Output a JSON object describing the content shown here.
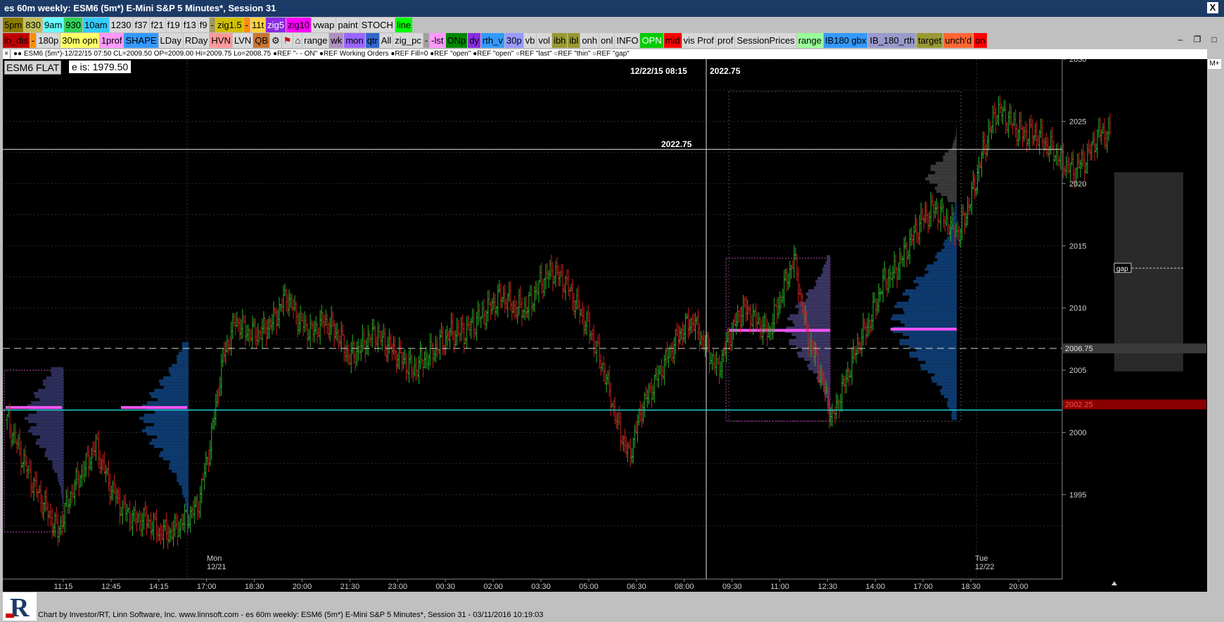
{
  "window": {
    "title": "es 60m weekly: ESM6 (5m*) E-Mini S&P 5 Minutes*, Session 31",
    "close_label": "X"
  },
  "toolbar1": [
    {
      "label": "5pm",
      "bg": "#8b7d00",
      "fg": "#000"
    },
    {
      "label": "830",
      "bg": "#c0c060",
      "fg": "#000"
    },
    {
      "label": "9am",
      "bg": "#66ffff",
      "fg": "#000"
    },
    {
      "label": "930",
      "bg": "#2fd35a",
      "fg": "#000"
    },
    {
      "label": "10am",
      "bg": "#33ccff",
      "fg": "#000"
    },
    {
      "label": "1230",
      "bg": "#d8d8d8",
      "fg": "#000"
    },
    {
      "label": "f37",
      "bg": "#d8d8d8",
      "fg": "#000"
    },
    {
      "label": "f21",
      "bg": "#d8d8d8",
      "fg": "#000"
    },
    {
      "label": "f19",
      "bg": "#d8d8d8",
      "fg": "#000"
    },
    {
      "label": "f13",
      "bg": "#d8d8d8",
      "fg": "#000"
    },
    {
      "label": "f9",
      "bg": "#d8d8d8",
      "fg": "#000"
    },
    {
      "label": "-",
      "bg": "#a09a60",
      "fg": "#000"
    },
    {
      "label": "zig1.5",
      "bg": "#d0c000",
      "fg": "#000"
    },
    {
      "label": "-",
      "bg": "#ff8c00",
      "fg": "#000"
    },
    {
      "label": "11t",
      "bg": "#ffd040",
      "fg": "#000"
    },
    {
      "label": "zig5",
      "bg": "#8a2be2",
      "fg": "#fff"
    },
    {
      "label": "zig10",
      "bg": "#ff00ff",
      "fg": "#000"
    },
    {
      "label": "vwap",
      "bg": "#d8d8d8",
      "fg": "#000"
    },
    {
      "label": "paint",
      "bg": "#d8d8d8",
      "fg": "#000"
    },
    {
      "label": "STOCH",
      "bg": "#d8d8d8",
      "fg": "#000"
    },
    {
      "label": "line",
      "bg": "#00ff00",
      "fg": "#000"
    }
  ],
  "toolbar2": [
    {
      "label": "ib_dis",
      "bg": "#c00000",
      "fg": "#000"
    },
    {
      "label": "-",
      "bg": "#ff8c00",
      "fg": "#000"
    },
    {
      "label": "180p",
      "bg": "#d8d8d8",
      "fg": "#000"
    },
    {
      "label": "30m opn",
      "bg": "#ffff66",
      "fg": "#000"
    },
    {
      "label": "1prof",
      "bg": "#ff99ff",
      "fg": "#000"
    },
    {
      "label": "SHAPE",
      "bg": "#3399ff",
      "fg": "#000"
    },
    {
      "label": "LDay",
      "bg": "#d8d8d8",
      "fg": "#000"
    },
    {
      "label": "RDay",
      "bg": "#d8d8d8",
      "fg": "#000"
    },
    {
      "label": "HVN",
      "bg": "#ff9999",
      "fg": "#000"
    },
    {
      "label": "LVN",
      "bg": "#d8d8d8",
      "fg": "#000"
    },
    {
      "label": "QB",
      "bg": "#c87533",
      "fg": "#000"
    },
    {
      "label": "⚙",
      "bg": "#d8d8d8",
      "fg": "#000"
    },
    {
      "label": "⚑",
      "bg": "#d8d8d8",
      "fg": "#c00"
    },
    {
      "label": "⌂",
      "bg": "#d8d8d8",
      "fg": "#000"
    },
    {
      "label": "range",
      "bg": "#d8d8d8",
      "fg": "#000"
    },
    {
      "label": "wk",
      "bg": "#b090c0",
      "fg": "#000"
    },
    {
      "label": "mon",
      "bg": "#9966ff",
      "fg": "#000"
    },
    {
      "label": "qtr",
      "bg": "#3366cc",
      "fg": "#000"
    },
    {
      "label": "All",
      "bg": "#d8d8d8",
      "fg": "#000"
    },
    {
      "label": "zig_pc",
      "bg": "#d8d8d8",
      "fg": "#000"
    },
    {
      "label": "-",
      "bg": "#a0a0a0",
      "fg": "#000"
    },
    {
      "label": "-lst",
      "bg": "#ff99ff",
      "fg": "#000"
    },
    {
      "label": "ONp",
      "bg": "#008800",
      "fg": "#000"
    },
    {
      "label": "dy",
      "bg": "#8a2be2",
      "fg": "#000"
    },
    {
      "label": "rth_v",
      "bg": "#3399ff",
      "fg": "#000"
    },
    {
      "label": "30p",
      "bg": "#9999ff",
      "fg": "#000"
    },
    {
      "label": "vb",
      "bg": "#d8d8d8",
      "fg": "#000"
    },
    {
      "label": "vol",
      "bg": "#d8d8d8",
      "fg": "#000"
    },
    {
      "label": "ibh",
      "bg": "#999933",
      "fg": "#000"
    },
    {
      "label": "ibl",
      "bg": "#999933",
      "fg": "#000"
    },
    {
      "label": "onh",
      "bg": "#d8d8d8",
      "fg": "#000"
    },
    {
      "label": "onl",
      "bg": "#d8d8d8",
      "fg": "#000"
    },
    {
      "label": "INFO",
      "bg": "#d8d8d8",
      "fg": "#000"
    },
    {
      "label": "OPN",
      "bg": "#00cc00",
      "fg": "#fff"
    },
    {
      "label": "mid",
      "bg": "#ff0000",
      "fg": "#000"
    },
    {
      "label": "vis Prof",
      "bg": "#d8d8d8",
      "fg": "#000"
    },
    {
      "label": "prof",
      "bg": "#d8d8d8",
      "fg": "#000"
    },
    {
      "label": "SessionPrices",
      "bg": "#d8d8d8",
      "fg": "#000"
    },
    {
      "label": "range",
      "bg": "#99ff99",
      "fg": "#000"
    },
    {
      "label": "IB180 gbx",
      "bg": "#3399ff",
      "fg": "#000"
    },
    {
      "label": "IB_180_rth",
      "bg": "#9999cc",
      "fg": "#000"
    },
    {
      "label": "target",
      "bg": "#999933",
      "fg": "#000"
    },
    {
      "label": "unch'd",
      "bg": "#ff6633",
      "fg": "#000"
    },
    {
      "label": "on",
      "bg": "#ff0000",
      "fg": "#000"
    }
  ],
  "legend": "●● ESM6 (5m*)-12/22/15 07:50 CL=2009.50 OP=2009.00 Hi=2009.75 Lo=2008.75  ●REF \"- - ON\"  ●REF Working Orders  ●REF Fill=0  ●REF \"open\"  ●REF \"open\"  ○REF \"last\"  ○REF \"thin\"  ○REF \"gap\"",
  "m_plus": "M+",
  "overlay": {
    "position_label": "ESM6 FLAT",
    "last_price_label": "e is: 1979.50",
    "crosshair_datetime": "12/22/15 08:15",
    "crosshair_price": "2022.75",
    "crosshair_price_left": "2022.75"
  },
  "footer": "Chart by Investor/RT, Linn Software, Inc. www.linnsoft.com - es 60m weekly: ESM6 (5m*) E-Mini S&P 5 Minutes*, Session 31 - 03/11/2016 10:19:03",
  "chart_data": {
    "type": "line",
    "title": "",
    "xlabel": "",
    "ylabel": "",
    "ylim": [
      1992,
      2030
    ],
    "y_ticks": [
      1995,
      2000,
      2005,
      2010,
      2015,
      2020,
      2025,
      2030
    ],
    "x_ticks": [
      "11:15",
      "12:45",
      "14:15",
      "17:00",
      "18:30",
      "20:00",
      "21:30",
      "23:00",
      "00:30",
      "02:00",
      "03:30",
      "05:00",
      "06:30",
      "08:00",
      "09:30",
      "11:00",
      "12:30",
      "14:00",
      "17:00",
      "18:30",
      "20:00"
    ],
    "day_labels": [
      {
        "day": "Mon",
        "date": "12/21"
      },
      {
        "day": "Tue",
        "date": "12/22"
      }
    ],
    "price_labels": [
      {
        "value": 2006.75,
        "label": "2006.75"
      },
      {
        "value": 2002.25,
        "label": "2002.25"
      }
    ],
    "reference_lines": [
      {
        "value": 2022.75,
        "name": "crosshair"
      },
      {
        "value": 2006.75,
        "name": "dashed"
      },
      {
        "value": 2001.8,
        "name": "cyan"
      }
    ],
    "gap_label": "gap",
    "gap_zone": [
      2004.9,
      2020.9
    ],
    "value_area_box": [
      2000.9,
      2027.4
    ],
    "profile_box": [
      2000.9,
      2014.0
    ],
    "price_path": [
      [
        0,
        2001
      ],
      [
        1,
        1998.5
      ],
      [
        2,
        1996
      ],
      [
        3,
        1994
      ],
      [
        4,
        1992
      ],
      [
        5,
        1995
      ],
      [
        6,
        1997
      ],
      [
        7,
        1999
      ],
      [
        8,
        1996
      ],
      [
        9,
        1994
      ],
      [
        10,
        1993
      ],
      [
        11,
        1993
      ],
      [
        12,
        1992
      ],
      [
        13,
        1992
      ],
      [
        14,
        1993
      ],
      [
        15,
        1994
      ],
      [
        16,
        1999
      ],
      [
        17,
        2006
      ],
      [
        18,
        2009
      ],
      [
        19,
        2008
      ],
      [
        20,
        2008
      ],
      [
        21,
        2009
      ],
      [
        22,
        2011
      ],
      [
        23,
        2009
      ],
      [
        24,
        2008
      ],
      [
        25,
        2009
      ],
      [
        26,
        2008
      ],
      [
        27,
        2006
      ],
      [
        28,
        2007
      ],
      [
        29,
        2008
      ],
      [
        30,
        2007
      ],
      [
        31,
        2006
      ],
      [
        32,
        2005
      ],
      [
        33,
        2006
      ],
      [
        34,
        2007
      ],
      [
        35,
        2008
      ],
      [
        36,
        2008
      ],
      [
        37,
        2009
      ],
      [
        38,
        2010
      ],
      [
        39,
        2011
      ],
      [
        40,
        2010
      ],
      [
        41,
        2010
      ],
      [
        42,
        2012
      ],
      [
        43,
        2013
      ],
      [
        44,
        2012
      ],
      [
        45,
        2010
      ],
      [
        46,
        2008
      ],
      [
        47,
        2005
      ],
      [
        48,
        2001
      ],
      [
        49,
        1998
      ],
      [
        50,
        2002
      ],
      [
        51,
        2004
      ],
      [
        52,
        2006
      ],
      [
        53,
        2008
      ],
      [
        54,
        2009
      ],
      [
        55,
        2007
      ],
      [
        56,
        2005
      ],
      [
        57,
        2008
      ],
      [
        58,
        2010
      ],
      [
        59,
        2009
      ],
      [
        60,
        2008
      ],
      [
        61,
        2011
      ],
      [
        62,
        2014
      ],
      [
        63,
        2008
      ],
      [
        64,
        2005
      ],
      [
        65,
        2001
      ],
      [
        66,
        2004
      ],
      [
        67,
        2007
      ],
      [
        68,
        2009
      ],
      [
        69,
        2012
      ],
      [
        70,
        2013
      ],
      [
        71,
        2015
      ],
      [
        72,
        2017
      ],
      [
        73,
        2018
      ],
      [
        74,
        2017
      ],
      [
        75,
        2016
      ],
      [
        76,
        2019
      ],
      [
        77,
        2023
      ],
      [
        78,
        2026
      ],
      [
        79,
        2025
      ],
      [
        80,
        2024
      ],
      [
        81,
        2024
      ],
      [
        82,
        2023
      ],
      [
        83,
        2022
      ],
      [
        84,
        2021
      ],
      [
        85,
        2022
      ],
      [
        86,
        2024
      ],
      [
        87,
        2024
      ]
    ]
  }
}
